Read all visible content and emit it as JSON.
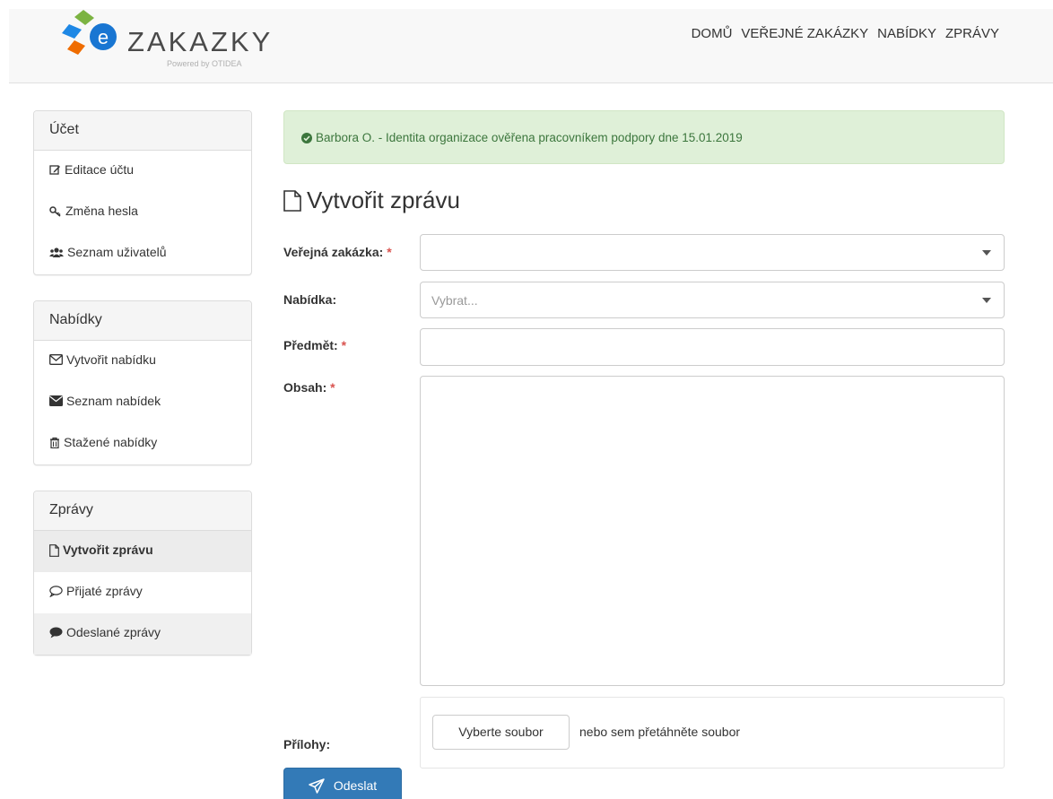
{
  "header": {
    "logo_text": "ZAKAZKY",
    "logo_sub": "Powered by OTIDEA",
    "nav": [
      "DOMŮ",
      "VEŘEJNÉ ZAKÁZKY",
      "NABÍDKY",
      "ZPRÁVY"
    ]
  },
  "sidebar": {
    "ucet": {
      "title": "Účet",
      "items": [
        "Editace účtu",
        "Změna hesla",
        "Seznam uživatelů"
      ]
    },
    "nabidky": {
      "title": "Nabídky",
      "items": [
        "Vytvořit nabídku",
        "Seznam nabídek",
        "Stažené nabídky"
      ]
    },
    "zpravy": {
      "title": "Zprávy",
      "items": [
        "Vytvořit zprávu",
        "Přijaté zprávy",
        "Odeslané zprávy"
      ]
    }
  },
  "alert": {
    "text": "Barbora O. - Identita organizace ověřena pracovníkem podpory dne 15.01.2019"
  },
  "form": {
    "title": "Vytvořit zprávu",
    "zakazka_label": "Veřejná zakázka:",
    "zakazka_value": "",
    "nabidka_label": "Nabídka:",
    "nabidka_placeholder": "Vybrat...",
    "predmet_label": "Předmět:",
    "predmet_value": "",
    "obsah_label": "Obsah:",
    "obsah_value": "",
    "prilohy_label": "Přílohy:",
    "file_button": "Vyberte soubor",
    "drop_text": "nebo sem přetáhněte soubor",
    "required_mark": "*",
    "submit_label": "Odeslat"
  },
  "colors": {
    "alert_bg": "#dff0d8",
    "alert_text": "#3c763d",
    "primary": "#337ab7",
    "required": "#d9534f"
  }
}
